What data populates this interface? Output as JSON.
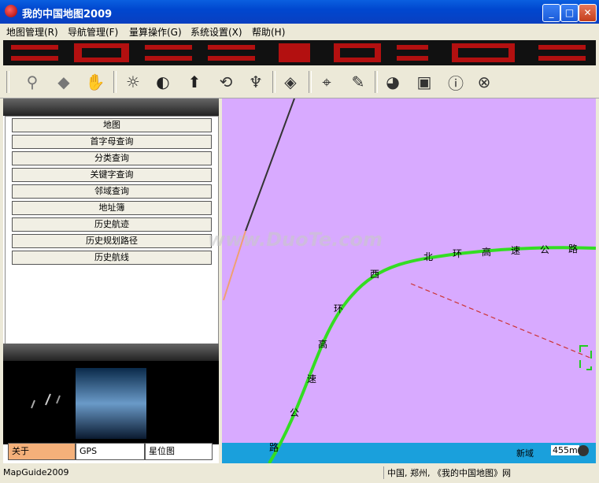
{
  "window": {
    "title": "我的中国地图2009"
  },
  "menu": [
    {
      "label": "地图管理(R)"
    },
    {
      "label": "导航管理(F)"
    },
    {
      "label": "量算操作(G)"
    },
    {
      "label": "系统设置(X)"
    },
    {
      "label": "帮助(H)"
    }
  ],
  "toolbar": [
    "pin-icon",
    "shape-icon",
    "hand-icon",
    "sun-icon",
    "moon-icon",
    "north-arrow-icon",
    "sync-icon",
    "antenna-icon",
    "layer-icon",
    "crosshair-icon",
    "ruler-icon",
    "globe-icon",
    "monitor-icon",
    "info-icon",
    "close-circle-icon"
  ],
  "nav_items": [
    {
      "label": "地图"
    },
    {
      "label": "首字母查询"
    },
    {
      "label": "分类查询"
    },
    {
      "label": "关键字查询"
    },
    {
      "label": "邻域查询"
    },
    {
      "label": "地址簿"
    },
    {
      "label": "历史航迹"
    },
    {
      "label": "历史规划路径"
    },
    {
      "label": "历史航线"
    }
  ],
  "bottom_tabs": [
    {
      "label": "关于"
    },
    {
      "label": "GPS"
    },
    {
      "label": "星位图"
    }
  ],
  "map": {
    "road_labels": [
      "西",
      "北",
      "环",
      "高",
      "速",
      "公",
      "路",
      "环",
      "高",
      "速",
      "公",
      "路"
    ],
    "scale_label": "455m",
    "corner_label": "新域",
    "background_color": "#d8aaff",
    "road_color": "#33dd22",
    "watermark": "www.DuoTe.com"
  },
  "status": {
    "left": "MapGuide2009",
    "right": "中国, 郑州, 《我的中国地图》网"
  }
}
